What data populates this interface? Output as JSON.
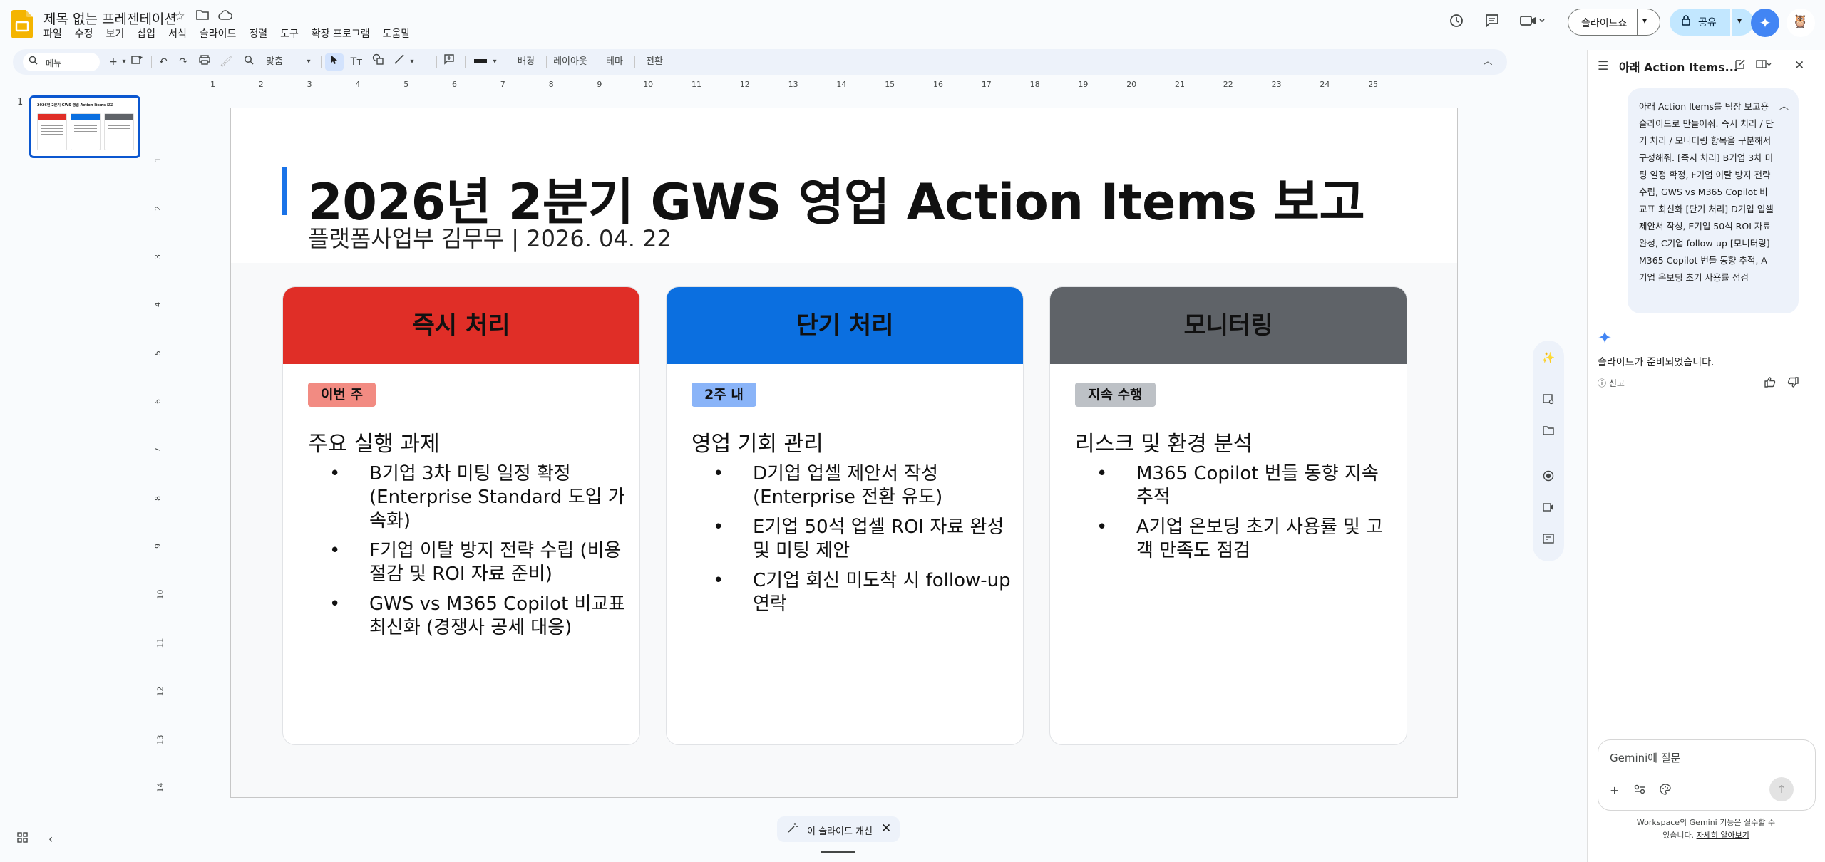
{
  "app": {
    "doc_title": "제목 없는 프레젠테이션",
    "menus": [
      "파일",
      "수정",
      "보기",
      "삽입",
      "서식",
      "슬라이드",
      "정렬",
      "도구",
      "확장 프로그램",
      "도움말"
    ],
    "slideshow_label": "슬라이드쇼",
    "share_label": "공유",
    "colors": {
      "accent": "#0b57d0",
      "share_bg": "#c2e7ff"
    }
  },
  "toolbar": {
    "search_placeholder": "메뉴",
    "zoom_label": "맞춤",
    "background_label": "배경",
    "layout_label": "레이아웃",
    "theme_label": "테마",
    "transition_label": "전환"
  },
  "rulers": {
    "horizontal": [
      "1",
      "2",
      "3",
      "4",
      "5",
      "6",
      "7",
      "8",
      "9",
      "10",
      "11",
      "12",
      "13",
      "14",
      "15",
      "16",
      "17",
      "18",
      "19",
      "20",
      "21",
      "22",
      "23",
      "24",
      "25"
    ],
    "vertical": [
      "1",
      "2",
      "3",
      "4",
      "5",
      "6",
      "7",
      "8",
      "9",
      "10",
      "11",
      "12",
      "13",
      "14"
    ]
  },
  "filmstrip": {
    "slide_number": "1",
    "thumb_title": "2026년 2분기 GWS 영업 Action Items 보고"
  },
  "slide": {
    "title": "2026년 2분기 GWS 영업 Action Items 보고",
    "subtitle": "플랫폼사업부 김무무 | 2026. 04. 22",
    "columns": [
      {
        "header": "즉시 처리",
        "header_color": "#e02e27",
        "badge": "이번 주",
        "badge_color": "#f28b82",
        "subtitle": "주요 실행 과제",
        "items": [
          "B기업 3차 미팅 일정 확정 (Enterprise Standard 도입 가속화)",
          "F기업 이탈 방지 전략 수립 (비용 절감 및 ROI 자료 준비)",
          "GWS vs M365 Copilot 비교표 최신화 (경쟁사 공세 대응)"
        ]
      },
      {
        "header": "단기 처리",
        "header_color": "#0b6fe0",
        "badge": "2주 내",
        "badge_color": "#8ab4f8",
        "subtitle": "영업 기회 관리",
        "items": [
          "D기업 업셀 제안서 작성 (Enterprise 전환 유도)",
          "E기업 50석 업셀 ROI 자료 완성 및 미팅 제안",
          "C기업 회신 미도착 시 follow-up 연락"
        ]
      },
      {
        "header": "모니터링",
        "header_color": "#5f6368",
        "badge": "지속 수행",
        "badge_color": "#bdc1c6",
        "subtitle": "리스크 및 환경 분석",
        "items": [
          "M365 Copilot 번들 동향 지속 추적",
          "A기업 온보딩 초기 사용률 및 고객 만족도 점검"
        ]
      }
    ]
  },
  "bottom_chip": {
    "label": "이 슬라이드 개선"
  },
  "gemini": {
    "panel_title": "아래 Action Items...",
    "user_message": "아래 Action Items를 팀장 보고용 슬라이드로 만들어줘. 즉시 처리 / 단기 처리 / 모니터링 항목을 구분해서 구성해줘. [즉시 처리] B기업 3차 미팅 일정 확정, F기업 이탈 방지 전략 수립, GWS vs M365 Copilot 비교표 최신화 [단기 처리] D기업 업셀 제안서 작성, E기업 50석 ROI 자료 완성, C기업 follow-up [모니터링] M365 Copilot 번들 동향 추적, A기업 온보딩 초기 사용률 점검",
    "reply": "슬라이드가 준비되었습니다.",
    "report_label": "신고",
    "input_placeholder": "Gemini에 질문",
    "disclaimer": "Workspace의 Gemini 기능은 실수할 수 있습니다.",
    "learn_more": "자세히 알아보기"
  }
}
